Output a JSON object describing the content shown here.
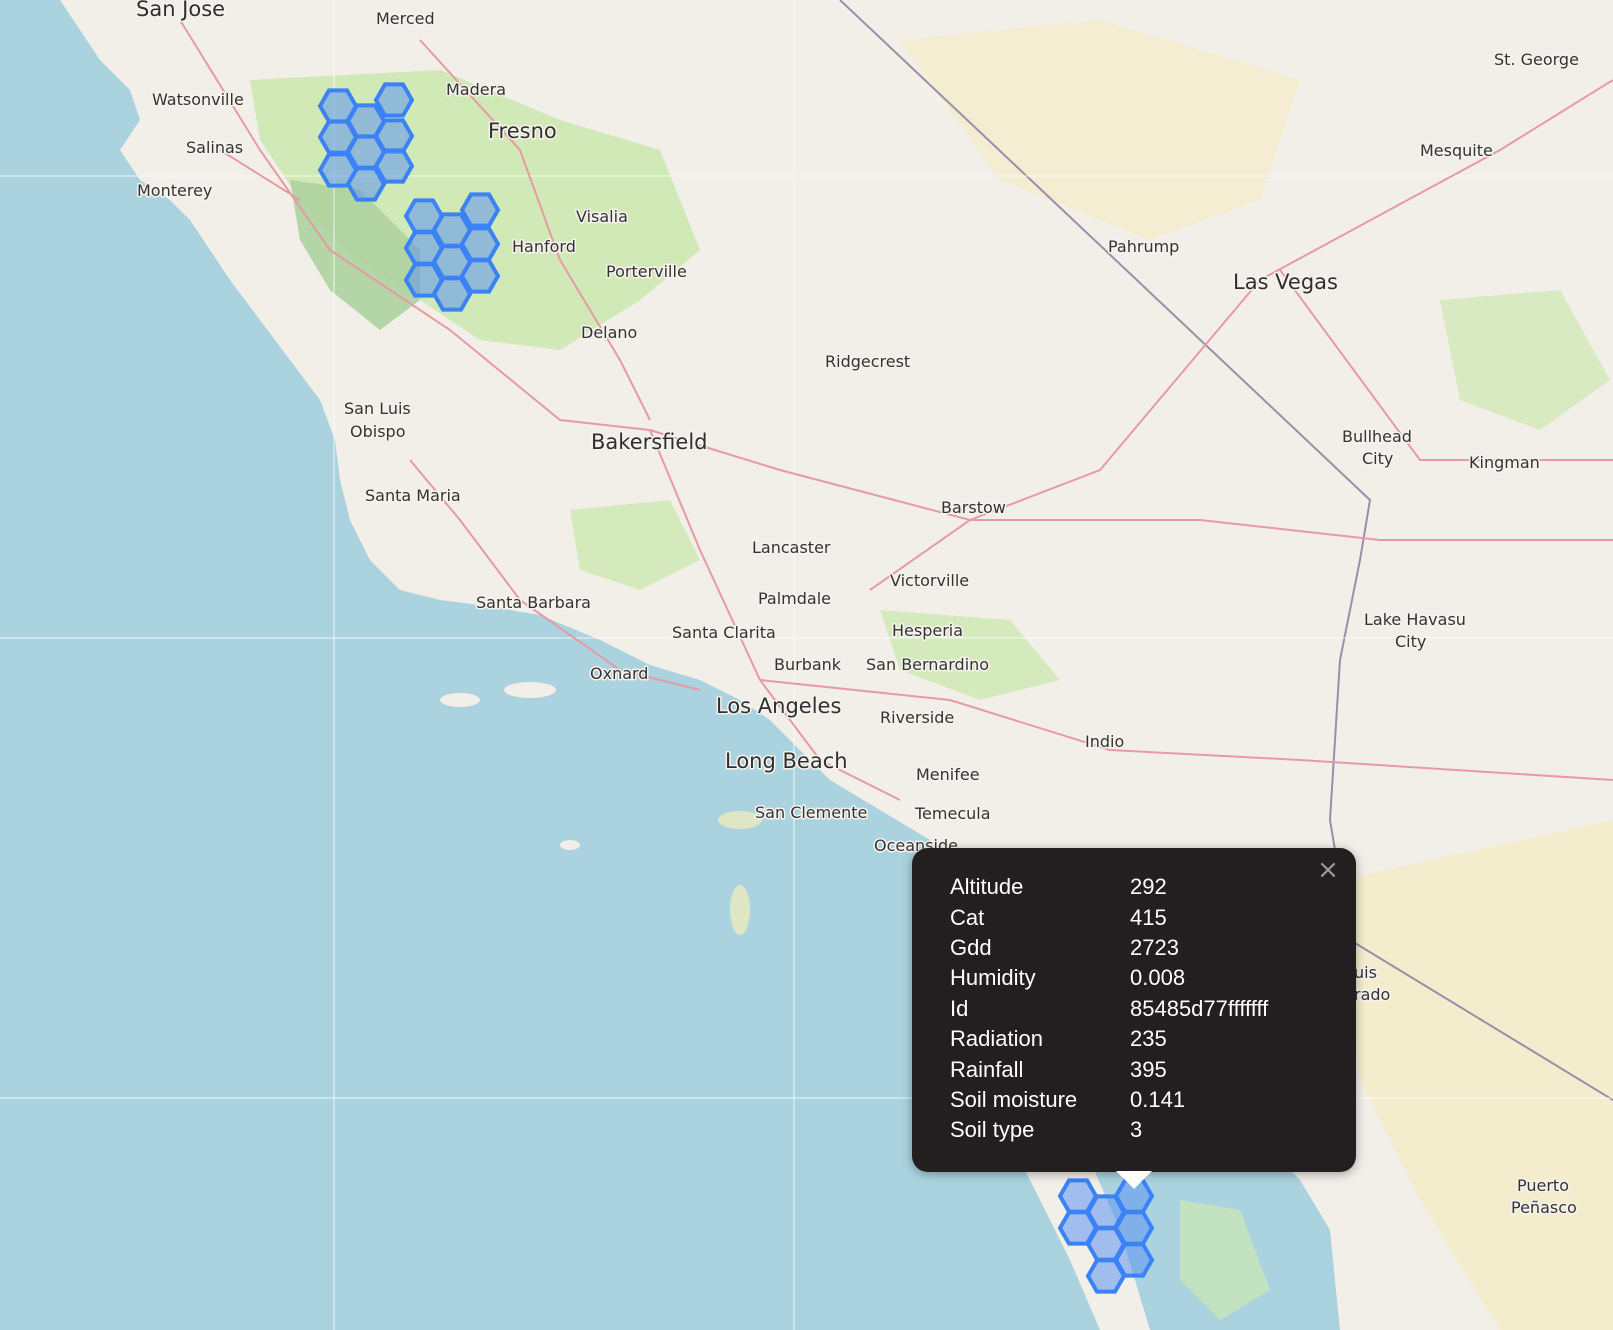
{
  "map": {
    "colors": {
      "water": "#aad3df",
      "land": "#f2efe9",
      "desert": "#f5ecc8",
      "park": "#cde8b0",
      "forest": "#add19e",
      "road": "#e79aa6",
      "hex_fill": "#5c94f0",
      "hex_stroke": "#3b82f6"
    },
    "place_labels": [
      "San Jose",
      "Merced",
      "Madera",
      "Fresno",
      "Watsonville",
      "Salinas",
      "Monterey",
      "Visalia",
      "Hanford",
      "Porterville",
      "Delano",
      "San Luis",
      "Obispo",
      "Bakersfield",
      "Santa Maria",
      "Santa Barbara",
      "Oxnard",
      "Lancaster",
      "Palmdale",
      "Santa Clarita",
      "Burbank",
      "Los Angeles",
      "Long Beach",
      "San Clemente",
      "Oceanside",
      "Riverside",
      "Menifee",
      "Temecula",
      "San Bernardino",
      "Hesperia",
      "Victorville",
      "Barstow",
      "Ridgecrest",
      "Pahrump",
      "Las Vegas",
      "St. George",
      "Mesquite",
      "Bullhead",
      "City",
      "Kingman",
      "Lake Havasu",
      "City",
      "Indio",
      "uis",
      "rado",
      "Puerto",
      "Peñasco"
    ],
    "hexagon_groups": [
      "cluster-north",
      "cluster-central",
      "cluster-south"
    ]
  },
  "popup": {
    "close_icon": "close-icon",
    "close_label": "×",
    "rows": [
      {
        "key": "Altitude",
        "value": "292"
      },
      {
        "key": "Cat",
        "value": "415"
      },
      {
        "key": "Gdd",
        "value": "2723"
      },
      {
        "key": "Humidity",
        "value": "0.008"
      },
      {
        "key": "Id",
        "value": "85485d77fffffff"
      },
      {
        "key": "Radiation",
        "value": "235"
      },
      {
        "key": "Rainfall",
        "value": "395"
      },
      {
        "key": "Soil moisture",
        "value": "0.141"
      },
      {
        "key": "Soil type",
        "value": "3"
      }
    ]
  }
}
